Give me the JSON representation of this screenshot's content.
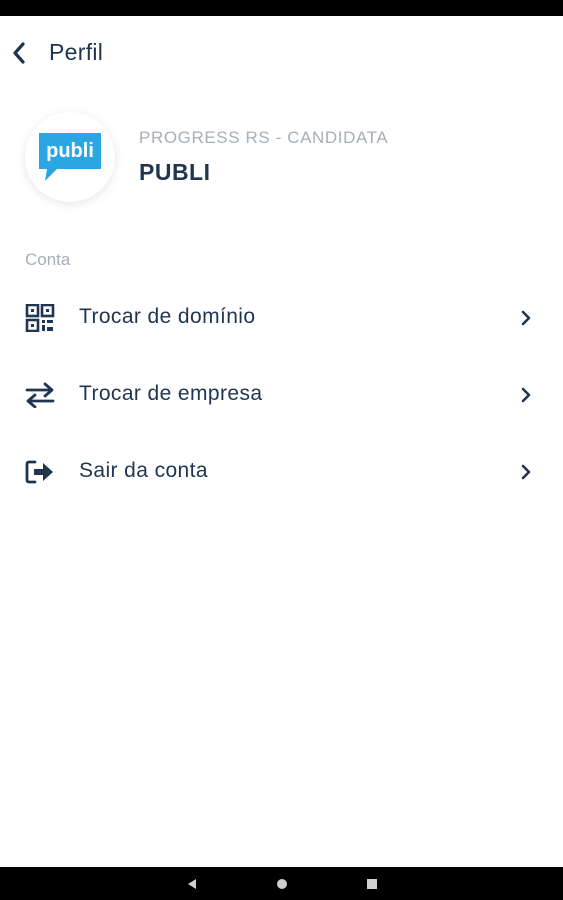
{
  "header": {
    "title": "Perfil",
    "back_icon": "chevron-left-icon"
  },
  "profile": {
    "logo_text": "publi",
    "company_subtitle": "PROGRESS RS - CANDIDATA",
    "company_name": "PUBLI"
  },
  "account": {
    "section_label": "Conta",
    "items": [
      {
        "label": "Trocar de domínio",
        "icon": "qr-code-icon"
      },
      {
        "label": "Trocar de empresa",
        "icon": "swap-arrows-icon"
      },
      {
        "label": "Sair da conta",
        "icon": "logout-icon"
      }
    ]
  },
  "colors": {
    "primary_text": "#1f3550",
    "muted_text": "#a8afb8",
    "logo_blue": "#2aa7e2"
  }
}
